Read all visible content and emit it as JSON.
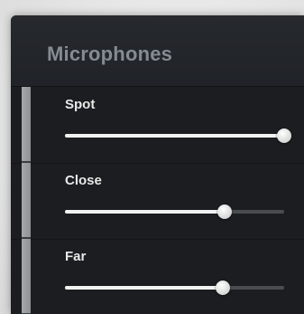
{
  "panel": {
    "title": "Microphones"
  },
  "channels": [
    {
      "label": "Spot",
      "level": 1.0
    },
    {
      "label": "Close",
      "level": 0.73
    },
    {
      "label": "Far",
      "level": 0.72
    }
  ],
  "colors": {
    "panel_bg": "#1b1d20",
    "title_text": "#858b93",
    "label_text": "#e8e8e8",
    "slider_fill": "#f2f2f2",
    "slider_track": "#4a4d50",
    "side_bar": "#a5a8ab"
  }
}
